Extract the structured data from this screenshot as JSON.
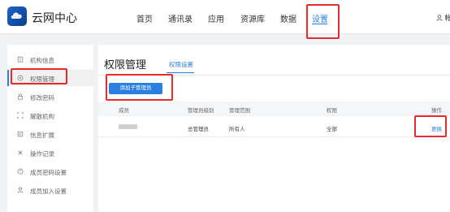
{
  "header": {
    "app_title": "云网中心",
    "nav": [
      {
        "label": "首页"
      },
      {
        "label": "通讯录"
      },
      {
        "label": "应用"
      },
      {
        "label": "资源库"
      },
      {
        "label": "数据"
      },
      {
        "label": "设置"
      }
    ],
    "active_nav": "设置",
    "user_label": "帐"
  },
  "sidebar": {
    "items": [
      {
        "label": "机构信息",
        "icon": "building-icon"
      },
      {
        "label": "权限管理",
        "icon": "shield-icon"
      },
      {
        "label": "修改密码",
        "icon": "lock-icon"
      },
      {
        "label": "解散机构",
        "icon": "dissolve-icon"
      },
      {
        "label": "信息扩展",
        "icon": "extend-icon"
      },
      {
        "label": "操作记录",
        "icon": "record-icon"
      },
      {
        "label": "成员密码设置",
        "icon": "key-icon"
      },
      {
        "label": "成员加入设置",
        "icon": "user-add-icon"
      }
    ],
    "active_item": "权限管理"
  },
  "main": {
    "title": "权限管理",
    "tab": "权限设置",
    "add_button": "添加子管理员",
    "table": {
      "headers": [
        "成员",
        "管理员级别",
        "管理范围",
        "权限",
        "操作"
      ],
      "rows": [
        {
          "member": "",
          "level": "总管理员",
          "scope": "所有人",
          "permission": "全部",
          "action": "更换"
        }
      ]
    }
  },
  "colors": {
    "accent": "#2b7fe0",
    "highlight": "#e52b2b"
  }
}
